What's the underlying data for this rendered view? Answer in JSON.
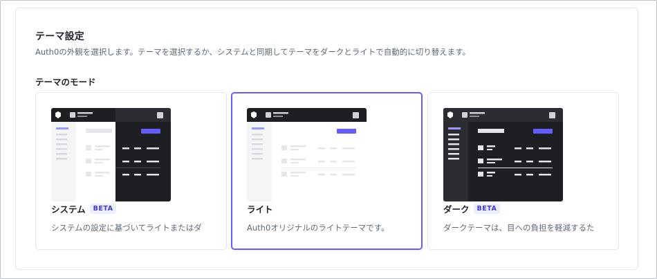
{
  "theme_settings": {
    "title": "テーマ設定",
    "description": "Auth0の外観を選択します。テーマを選択するか、システムと同期してテーマをダークとライトで自動的に切り替えます。",
    "mode_label": "テーマのモード",
    "colors": {
      "accent": "#635dff",
      "dark": "#1e1f23",
      "light": "#ffffff"
    },
    "options": [
      {
        "label": "システム",
        "badge": "BETA",
        "description": "システムの設定に基づいてライトまたはダ",
        "selected": false
      },
      {
        "label": "ライト",
        "badge": "",
        "description": "Auth0オリジナルのライトテーマです。",
        "selected": true
      },
      {
        "label": "ダーク",
        "badge": "BETA",
        "description": "ダークテーマは、目への負担を軽減するた",
        "selected": false
      }
    ]
  }
}
